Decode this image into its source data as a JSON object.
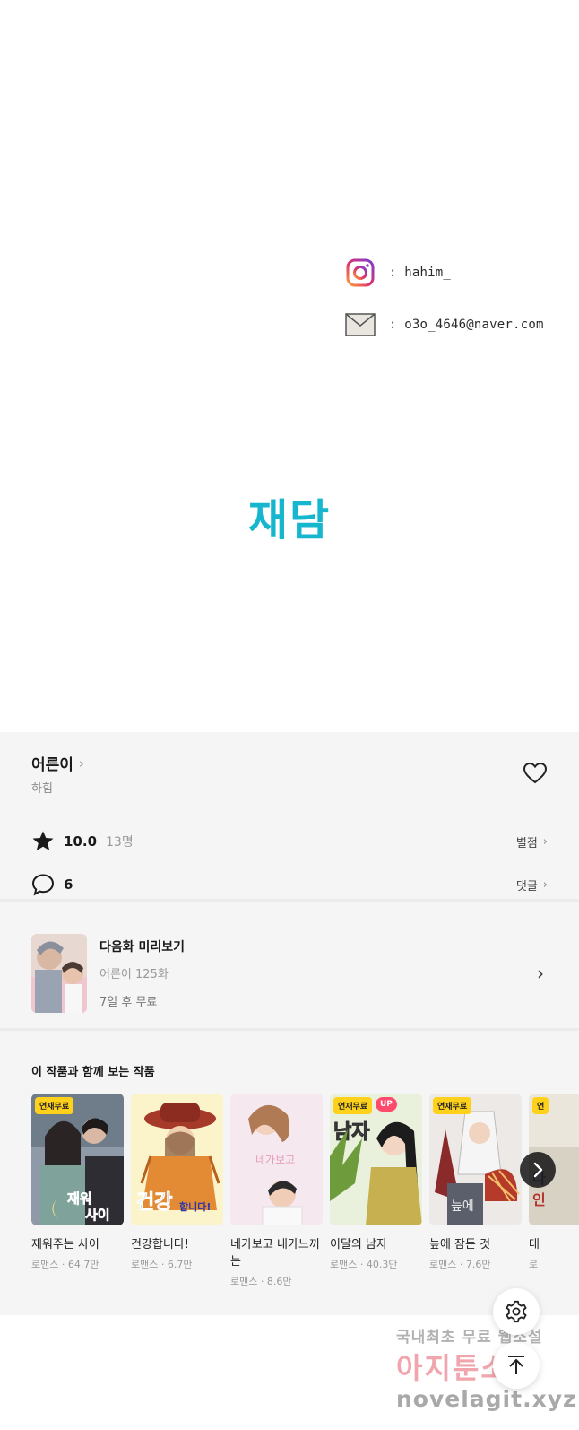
{
  "contacts": {
    "instagram": ": hahim_",
    "email": ": o3o_4646@naver.com"
  },
  "logo_text": "재담",
  "work": {
    "title": "어른이",
    "author": "하힘",
    "rating_score": "10.0",
    "rating_count": "13명",
    "rating_link": "별점",
    "comment_count": "6",
    "comment_link": "댓글"
  },
  "next_episode": {
    "label": "다음화 미리보기",
    "episode": "어른이 125화",
    "free_in": "7일 후 무료"
  },
  "recommendations": {
    "title": "이 작품과 함께 보는 작품",
    "items": [
      {
        "name": "재워주는 사이",
        "meta": "로맨스 · 64.7만",
        "badge": "연재무료",
        "up": ""
      },
      {
        "name": "건강합니다!",
        "meta": "로맨스 · 6.7만",
        "badge": "",
        "up": ""
      },
      {
        "name": "네가보고 내가느끼는",
        "meta": "로맨스 · 8.6만",
        "badge": "",
        "up": ""
      },
      {
        "name": "이달의 남자",
        "meta": "로맨스 · 40.3만",
        "badge": "연재무료",
        "up": "UP"
      },
      {
        "name": "늪에 잠든 것",
        "meta": "로맨스 · 7.6만",
        "badge": "연재무료",
        "up": ""
      },
      {
        "name": "대",
        "meta": "로",
        "badge": "연",
        "up": ""
      }
    ]
  },
  "watermark": {
    "line1": "국내최초 무료 웹소설",
    "line2": "아지툰소설",
    "line3": "novelagit.xyz"
  },
  "colors": {
    "logo": "#17b6cf",
    "panel_bg": "#f5f5f5",
    "badge": "#ffd11a",
    "badge_up": "#ff4a6b"
  }
}
